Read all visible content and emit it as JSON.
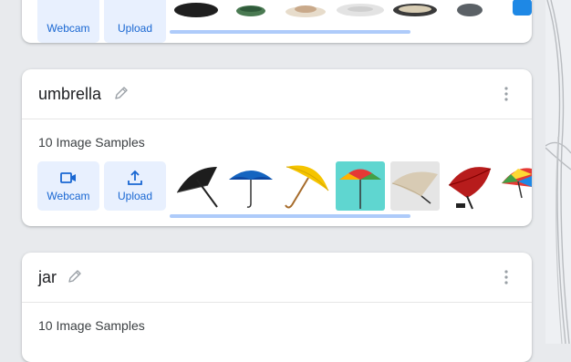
{
  "cards": [
    {
      "id": "top",
      "buttons": {
        "webcam": "Webcam",
        "upload": "Upload"
      },
      "thumbnail_icons": [
        "black-plate-icon",
        "green-bowl-icon",
        "white-cup-icon",
        "white-saucer-icon",
        "patterned-plate-icon",
        "grey-bowl-icon",
        "blue-cup-icon"
      ]
    },
    {
      "id": "umbrella",
      "name": "umbrella",
      "samples": "10 Image Samples",
      "buttons": {
        "webcam": "Webcam",
        "upload": "Upload"
      },
      "thumbnail_icons": [
        "black-umbrella-icon",
        "blue-umbrella-icon",
        "yellow-umbrella-icon",
        "rainbow-umbrella-icon",
        "beige-umbrella-icon",
        "red-umbrella-icon",
        "multicolor-umbrella-icon"
      ]
    },
    {
      "id": "jar",
      "name": "jar",
      "samples": "10 Image Samples"
    }
  ],
  "colors": {
    "accent": "#1967d2",
    "button_bg": "#e8f0fe",
    "scrollbar": "#aecbfa",
    "background": "#e8eaed"
  }
}
